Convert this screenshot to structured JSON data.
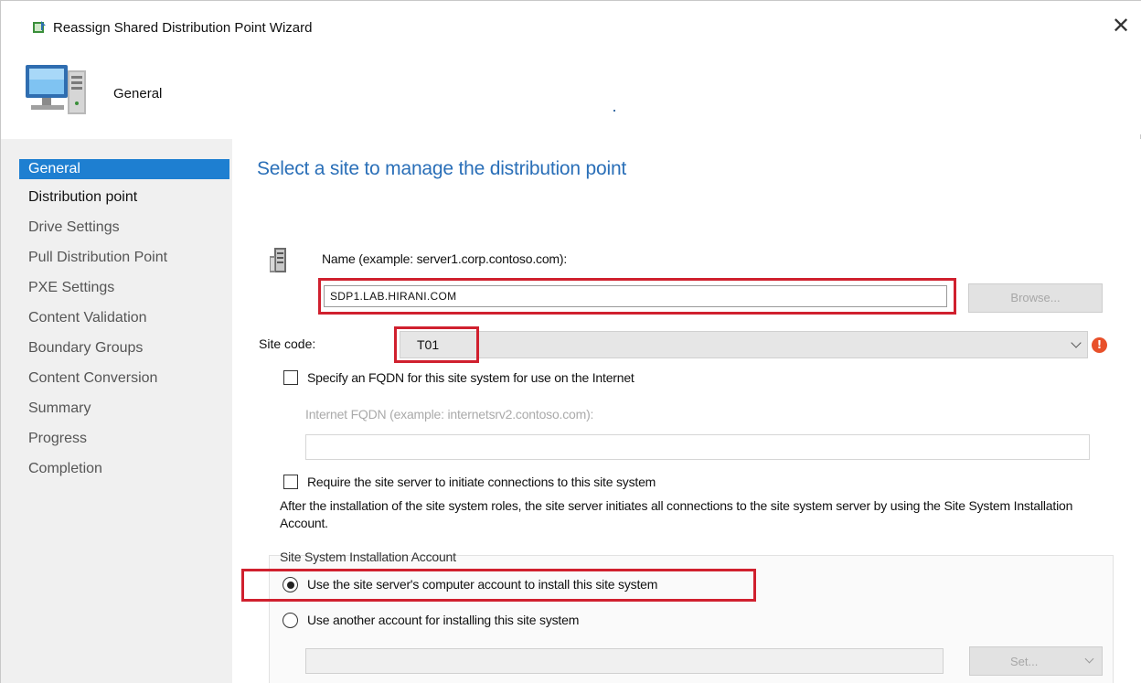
{
  "window": {
    "title": "Reassign Shared Distribution Point Wizard",
    "close_glyph": "✕",
    "title_icon": "wizard-icon"
  },
  "header": {
    "title": "General",
    "icon": "computer-icon"
  },
  "nav": {
    "items": [
      {
        "label": "General",
        "active": true
      },
      {
        "label": "Distribution point",
        "active": false
      },
      {
        "label": "Drive Settings",
        "active": false
      },
      {
        "label": "Pull Distribution Point",
        "active": false
      },
      {
        "label": "PXE Settings",
        "active": false
      },
      {
        "label": "Content Validation",
        "active": false
      },
      {
        "label": "Boundary Groups",
        "active": false
      },
      {
        "label": "Content Conversion",
        "active": false
      },
      {
        "label": "Summary",
        "active": false
      },
      {
        "label": "Progress",
        "active": false
      },
      {
        "label": "Completion",
        "active": false
      }
    ]
  },
  "main": {
    "title": "Select a site to manage the distribution point",
    "name_label": "Name (example: server1.corp.contoso.com):",
    "name_value": "SDP1.LAB.HIRANI.COM",
    "browse_label": "Browse...",
    "site_code_label": "Site code:",
    "site_code_value": "T01",
    "warning_glyph": "!",
    "fqdn_checkbox_label": "Specify an FQDN for this site system for use on the Internet",
    "fqdn_label": "Internet FQDN (example: internetsrv2.contoso.com):",
    "fqdn_value": "",
    "require_checkbox_label": "Require the site server to initiate connections to this site system",
    "info_text": "After the  installation of the site system roles, the site server initiates all connections to the site system server by using the Site System Installation Account.",
    "account_group_label": "Site System Installation Account",
    "radio_computer_account": "Use the site server's computer account to install this site system",
    "radio_other_account": "Use another account for installing this site system",
    "account_value": "",
    "set_label": "Set..."
  },
  "colors": {
    "accent": "#1e7fd1",
    "title_blue": "#2a6fb8",
    "highlight_red": "#d0202e",
    "warning_orange": "#e8502a"
  }
}
